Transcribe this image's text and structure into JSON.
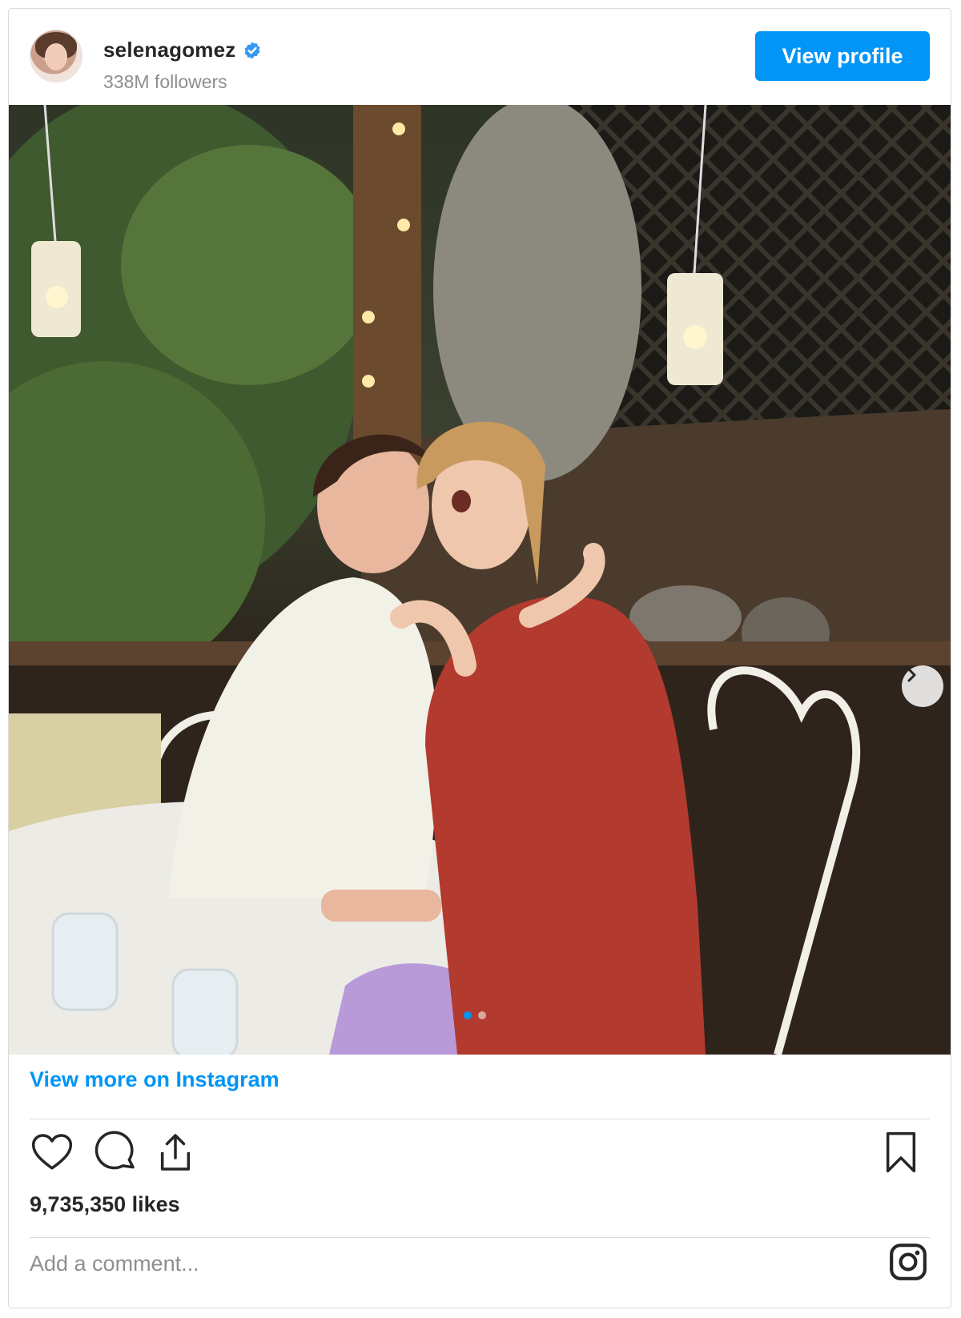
{
  "header": {
    "username": "selenagomez",
    "followers": "338M followers",
    "view_profile_label": "View profile"
  },
  "post": {
    "view_more_label": "View more on Instagram",
    "likes": "9,735,350 likes",
    "comment_placeholder": "Add a comment...",
    "carousel_total": 2,
    "carousel_active": 1
  },
  "colors": {
    "accent": "#0095f6",
    "verified": "#3897f0",
    "muted": "#8e8e8e"
  },
  "icons": {
    "verified": "verified-badge-icon",
    "like": "heart-icon",
    "comment": "comment-bubble-icon",
    "share": "share-icon",
    "save": "bookmark-icon",
    "next": "chevron-right-icon",
    "brand": "instagram-icon"
  }
}
